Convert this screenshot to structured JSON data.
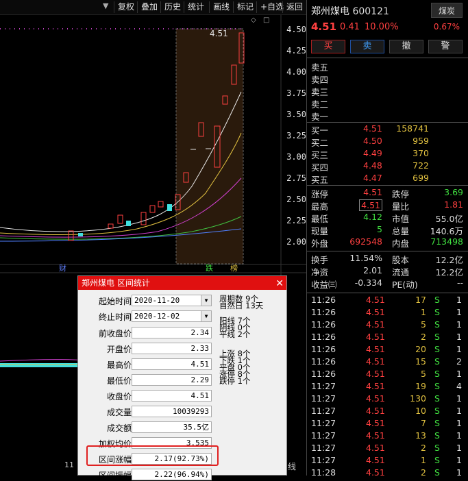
{
  "toolbar": {
    "items": [
      "复权",
      "叠加",
      "历史",
      "统计",
      "画线",
      "标记",
      "+自选",
      "返回"
    ]
  },
  "chart": {
    "y_ticks": [
      "4.50",
      "4.25",
      "4.00",
      "3.75",
      "3.50",
      "3.25",
      "3.00",
      "2.75",
      "2.50",
      "2.25",
      "2.00"
    ],
    "high_label": "4.51",
    "markers": {
      "cai": "财",
      "die": "跌",
      "bang": "榜"
    },
    "bottom_right": "线",
    "bottom_left_num": "11"
  },
  "quote": {
    "name": "郑州煤电",
    "code": "600121",
    "sector": "煤炭",
    "price": "4.51",
    "change": "0.41",
    "pct": "10.00%",
    "sector_pct": "0.67%"
  },
  "trade_buttons": [
    "买",
    "卖",
    "撤",
    "警"
  ],
  "asks": [
    "卖五",
    "卖四",
    "卖三",
    "卖二",
    "卖一"
  ],
  "bids": [
    {
      "label": "买一",
      "price": "4.51",
      "vol": "158741"
    },
    {
      "label": "买二",
      "price": "4.50",
      "vol": "959"
    },
    {
      "label": "买三",
      "price": "4.49",
      "vol": "370"
    },
    {
      "label": "买四",
      "price": "4.48",
      "vol": "722"
    },
    {
      "label": "买五",
      "price": "4.47",
      "vol": "699"
    }
  ],
  "stats": [
    {
      "l1": "涨停",
      "v1": "4.51",
      "l2": "跌停",
      "v2": "3.69"
    },
    {
      "l1": "最高",
      "v1": "4.51",
      "l2": "量比",
      "v2": "1.81"
    },
    {
      "l1": "最低",
      "v1": "4.12",
      "l2": "市值",
      "v2": "55.0亿"
    },
    {
      "l1": "现量",
      "v1": "5",
      "l2": "总量",
      "v2": "140.6万"
    },
    {
      "l1": "外盘",
      "v1": "692548",
      "l2": "内盘",
      "v2": "713498"
    }
  ],
  "stats2": [
    {
      "l1": "换手",
      "v1": "11.54%",
      "l2": "股本",
      "v2": "12.2亿"
    },
    {
      "l1": "净资",
      "v1": "2.01",
      "l2": "流通",
      "v2": "12.2亿"
    },
    {
      "l1": "收益㈢",
      "v1": "-0.334",
      "l2": "PE(动)",
      "v2": "--"
    }
  ],
  "ticks": [
    {
      "t": "11:26",
      "p": "4.51",
      "v": "17",
      "s": "S",
      "n": "1"
    },
    {
      "t": "11:26",
      "p": "4.51",
      "v": "1",
      "s": "S",
      "n": "1"
    },
    {
      "t": "11:26",
      "p": "4.51",
      "v": "5",
      "s": "S",
      "n": "1"
    },
    {
      "t": "11:26",
      "p": "4.51",
      "v": "2",
      "s": "S",
      "n": "1"
    },
    {
      "t": "11:26",
      "p": "4.51",
      "v": "20",
      "s": "S",
      "n": "1"
    },
    {
      "t": "11:26",
      "p": "4.51",
      "v": "15",
      "s": "S",
      "n": "2"
    },
    {
      "t": "11:26",
      "p": "4.51",
      "v": "5",
      "s": "S",
      "n": "1"
    },
    {
      "t": "11:27",
      "p": "4.51",
      "v": "19",
      "s": "S",
      "n": "4"
    },
    {
      "t": "11:27",
      "p": "4.51",
      "v": "130",
      "s": "S",
      "n": "1"
    },
    {
      "t": "11:27",
      "p": "4.51",
      "v": "10",
      "s": "S",
      "n": "1"
    },
    {
      "t": "11:27",
      "p": "4.51",
      "v": "7",
      "s": "S",
      "n": "1"
    },
    {
      "t": "11:27",
      "p": "4.51",
      "v": "13",
      "s": "S",
      "n": "1"
    },
    {
      "t": "11:27",
      "p": "4.51",
      "v": "2",
      "s": "S",
      "n": "1"
    },
    {
      "t": "11:27",
      "p": "4.51",
      "v": "1",
      "s": "S",
      "n": "1"
    },
    {
      "t": "11:28",
      "p": "4.51",
      "v": "2",
      "s": "S",
      "n": "1"
    }
  ],
  "dialog": {
    "title": "郑州煤电 区间统计",
    "start_label": "起始时间",
    "start_value": "2020-11-20",
    "end_label": "终止时间",
    "end_value": "2020-12-02",
    "fields": [
      {
        "label": "前收盘价",
        "value": "2.34"
      },
      {
        "label": "开盘价",
        "value": "2.33"
      },
      {
        "label": "最高价",
        "value": "4.51"
      },
      {
        "label": "最低价",
        "value": "2.29"
      },
      {
        "label": "收盘价",
        "value": "4.51"
      },
      {
        "label": "成交量",
        "value": "10039293"
      },
      {
        "label": "成交额",
        "value": "35.5亿"
      },
      {
        "label": "加权均价",
        "value": "3.535"
      },
      {
        "label": "区间涨幅",
        "value": "2.17(92.73%)"
      },
      {
        "label": "区间振幅",
        "value": "2.22(96.94%)"
      }
    ],
    "right_stats": [
      [
        "周期数 9个",
        "自然日 13天"
      ],
      [
        "阳线 7个",
        "阴线 0个",
        "平线 2个"
      ],
      [
        "上涨 8个",
        "下跌 1个",
        "平盘 0个",
        "涨停 8个",
        "跌停 1个"
      ]
    ]
  }
}
